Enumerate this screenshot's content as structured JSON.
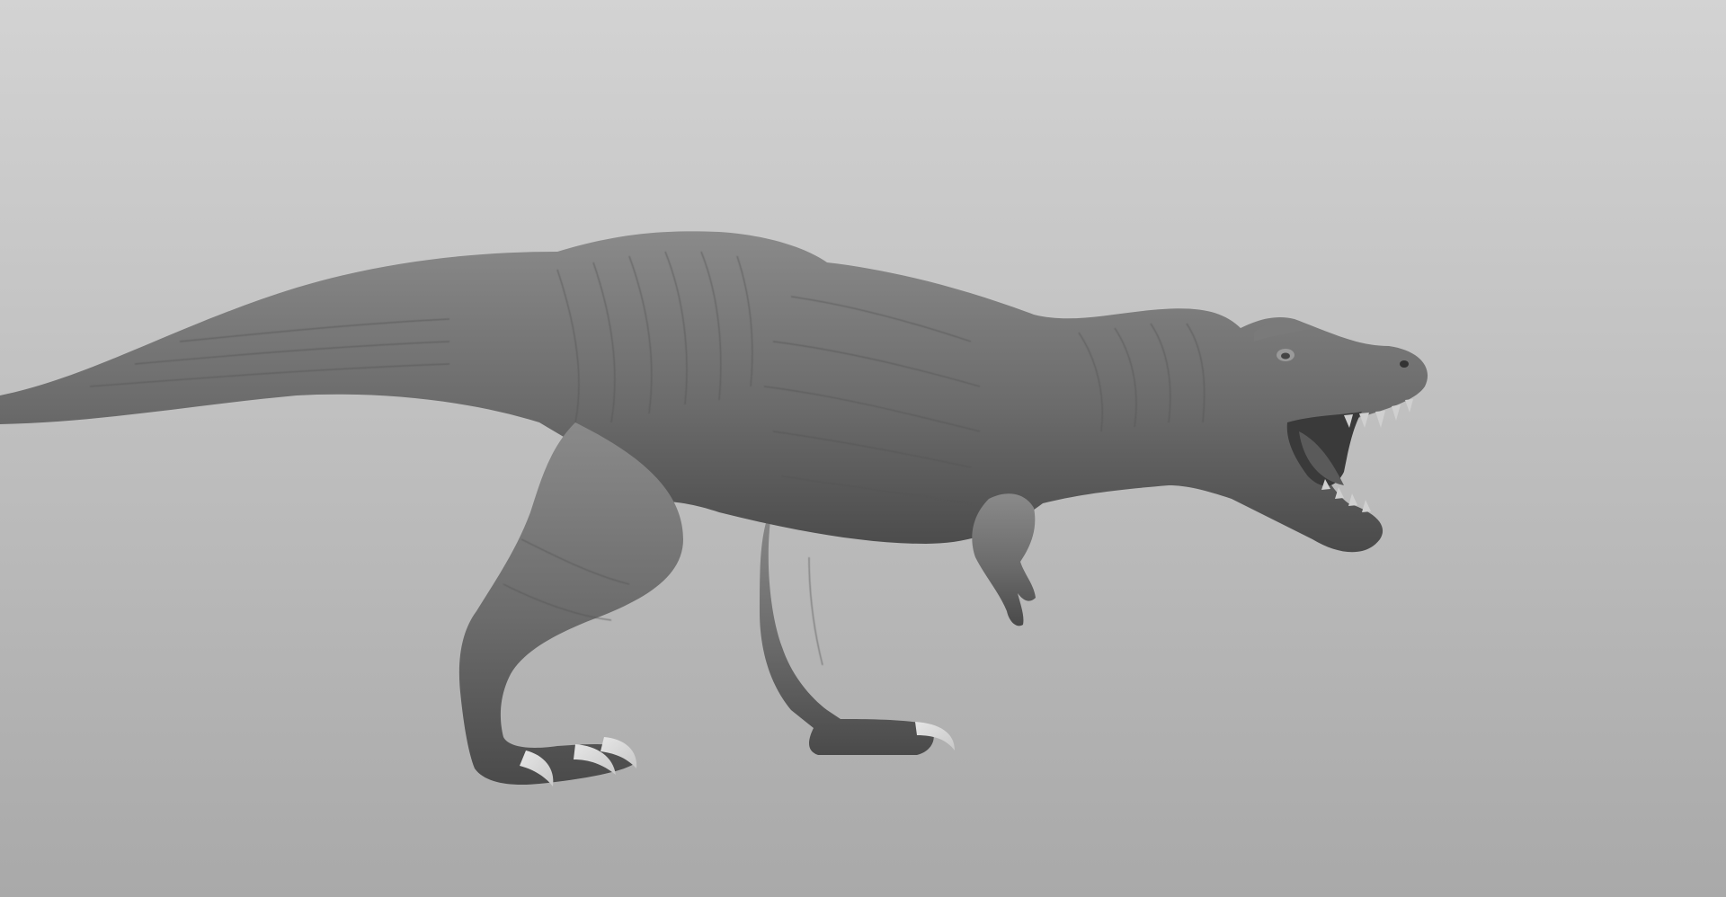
{
  "viewport": {
    "background_top": "#d3d3d3",
    "background_bottom": "#a9a9a9"
  },
  "model": {
    "subject": "tyrannosaurus-rex",
    "shading": "matcap-gray-clay",
    "skin_color": "#6b6b6b",
    "skin_dark": "#4a4a4a",
    "skin_light": "#8a8a8a",
    "claw_color": "#c8c8c8"
  }
}
